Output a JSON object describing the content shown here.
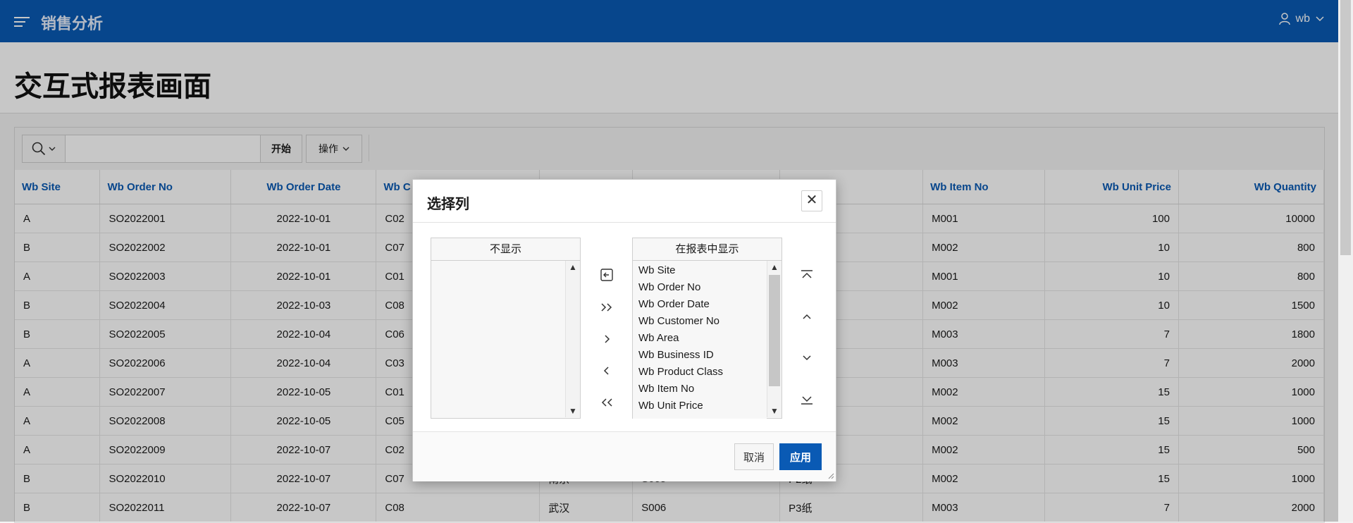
{
  "app": {
    "title": "销售分析",
    "user": "wb"
  },
  "page": {
    "title": "交互式报表画面"
  },
  "toolbar": {
    "go_label": "开始",
    "actions_label": "操作",
    "search_value": ""
  },
  "table": {
    "headers": [
      "Wb Site",
      "Wb Order No",
      "Wb Order Date",
      "Wb C",
      "",
      "",
      "uct Class",
      "Wb Item No",
      "Wb Unit Price",
      "Wb Quantity"
    ],
    "rows": [
      [
        "A",
        "SO2022001",
        "2022-10-01",
        "C02",
        "",
        "",
        "",
        "M001",
        "100",
        "10000"
      ],
      [
        "B",
        "SO2022002",
        "2022-10-01",
        "C07",
        "",
        "",
        "",
        "M002",
        "10",
        "800"
      ],
      [
        "A",
        "SO2022003",
        "2022-10-01",
        "C01",
        "",
        "",
        "",
        "M001",
        "10",
        "800"
      ],
      [
        "B",
        "SO2022004",
        "2022-10-03",
        "C08",
        "",
        "",
        "",
        "M002",
        "10",
        "1500"
      ],
      [
        "B",
        "SO2022005",
        "2022-10-04",
        "C06",
        "",
        "",
        "",
        "M003",
        "7",
        "1800"
      ],
      [
        "A",
        "SO2022006",
        "2022-10-04",
        "C03",
        "",
        "",
        "",
        "M003",
        "7",
        "2000"
      ],
      [
        "A",
        "SO2022007",
        "2022-10-05",
        "C01",
        "",
        "",
        "",
        "M002",
        "15",
        "1000"
      ],
      [
        "A",
        "SO2022008",
        "2022-10-05",
        "C05",
        "",
        "",
        "",
        "M002",
        "15",
        "1000"
      ],
      [
        "A",
        "SO2022009",
        "2022-10-07",
        "C02",
        "",
        "",
        "",
        "M002",
        "15",
        "500"
      ],
      [
        "B",
        "SO2022010",
        "2022-10-07",
        "C07",
        "南京",
        "S005",
        "P2纸",
        "M002",
        "15",
        "1000"
      ],
      [
        "B",
        "SO2022011",
        "2022-10-07",
        "C08",
        "武汉",
        "S006",
        "P3纸",
        "M003",
        "7",
        "2000"
      ]
    ]
  },
  "dialog": {
    "title": "选择列",
    "left_header": "不显示",
    "right_header": "在报表中显示",
    "right_items": [
      "Wb Site",
      "Wb Order No",
      "Wb Order Date",
      "Wb Customer No",
      "Wb Area",
      "Wb Business ID",
      "Wb Product Class",
      "Wb Item No",
      "Wb Unit Price"
    ],
    "cancel_label": "取消",
    "apply_label": "应用"
  }
}
